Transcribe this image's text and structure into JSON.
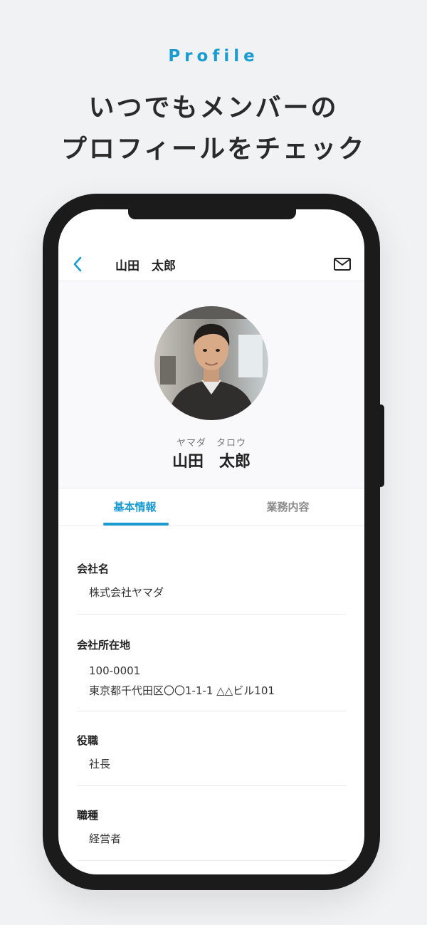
{
  "hero": {
    "eyebrow": "Profile",
    "line1": "いつでもメンバーの",
    "line2": "プロフィールをチェック"
  },
  "header": {
    "title": "山田　太郎",
    "back_icon": "chevron-left-icon",
    "mail_icon": "mail-icon"
  },
  "profile": {
    "kana": "ヤマダ　タロウ",
    "name": "山田　太郎"
  },
  "tabs": [
    {
      "label": "基本情報",
      "active": true
    },
    {
      "label": "業務内容",
      "active": false
    }
  ],
  "fields": [
    {
      "label": "会社名",
      "lines": [
        "株式会社ヤマダ"
      ]
    },
    {
      "label": "会社所在地",
      "lines": [
        "100-0001",
        "東京都千代田区〇〇1-1-1 △△ビル101"
      ]
    },
    {
      "label": "役職",
      "lines": [
        "社長"
      ]
    },
    {
      "label": "職種",
      "lines": [
        "経営者"
      ]
    }
  ],
  "colors": {
    "accent": "#1a9bd1",
    "background": "#f1f2f4",
    "phone_frame": "#1b1b1b",
    "tab_inactive": "#8a8a8a"
  }
}
